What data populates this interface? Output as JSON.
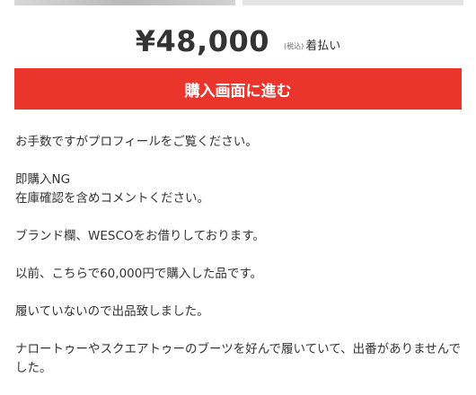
{
  "item": {
    "price": "¥48,000",
    "tax_label": "(税込)",
    "shipping_label": "着払い"
  },
  "actions": {
    "buy_label": "購入画面に進む"
  },
  "description": {
    "text": "お手数ですがプロフィールをご覧ください。\n\n即購入NG\n在庫確認を含めコメントください。\n\nブランド欄、WESCOをお借りしております。\n\n以前、こちらで60,000円で購入した品です。\n\n履いていないので出品致しました。\n\nナロートゥーやスクエアトゥーのブーツを好んで履いていて、出番がありませんでした。"
  },
  "colors": {
    "buy_button": "#ea352d",
    "text": "#333333"
  }
}
